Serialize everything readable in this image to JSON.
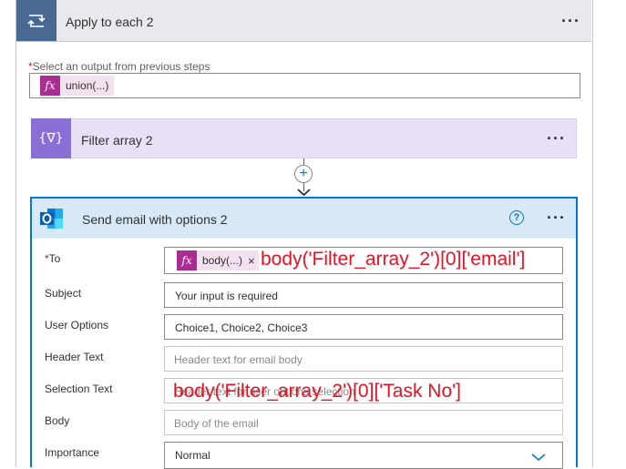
{
  "apply_each": {
    "title": "Apply to each 2",
    "menu": "···",
    "output_label": "Select an output from previous steps",
    "required_mark": "*",
    "token": "union(...)"
  },
  "filter": {
    "title": "Filter array 2",
    "menu": "···",
    "icon_glyph": "{∇}"
  },
  "email": {
    "title": "Send email with options 2",
    "menu": "···",
    "help": "?",
    "fields": {
      "to_label": "To",
      "to_required": "*",
      "to_token": "body(...)",
      "to_remove": "×",
      "to_overlay": "body('Filter_array_2')[0]['email']",
      "subject_label": "Subject",
      "subject_value": "Your input is required",
      "options_label": "User Options",
      "options_value": "Choice1, Choice2, Choice3",
      "header_label": "Header Text",
      "header_placeholder": "Header text for email body",
      "selection_label": "Selection Text",
      "selection_placeholder": "Header text for user options selection",
      "selection_overlay": "body('Filter_array_2')[0]['Task No']",
      "body_label": "Body",
      "body_placeholder": "Body of the email",
      "importance_label": "Importance",
      "importance_value": "Normal"
    }
  },
  "fx_glyph": "fx",
  "colors": {
    "loop_icon_bg": "#486991",
    "filter_icon_bg": "#8a6fd6",
    "token_fx_bg": "#aa2d94",
    "card_border_selected": "#0078d4",
    "overlay_red": "#e81123"
  }
}
